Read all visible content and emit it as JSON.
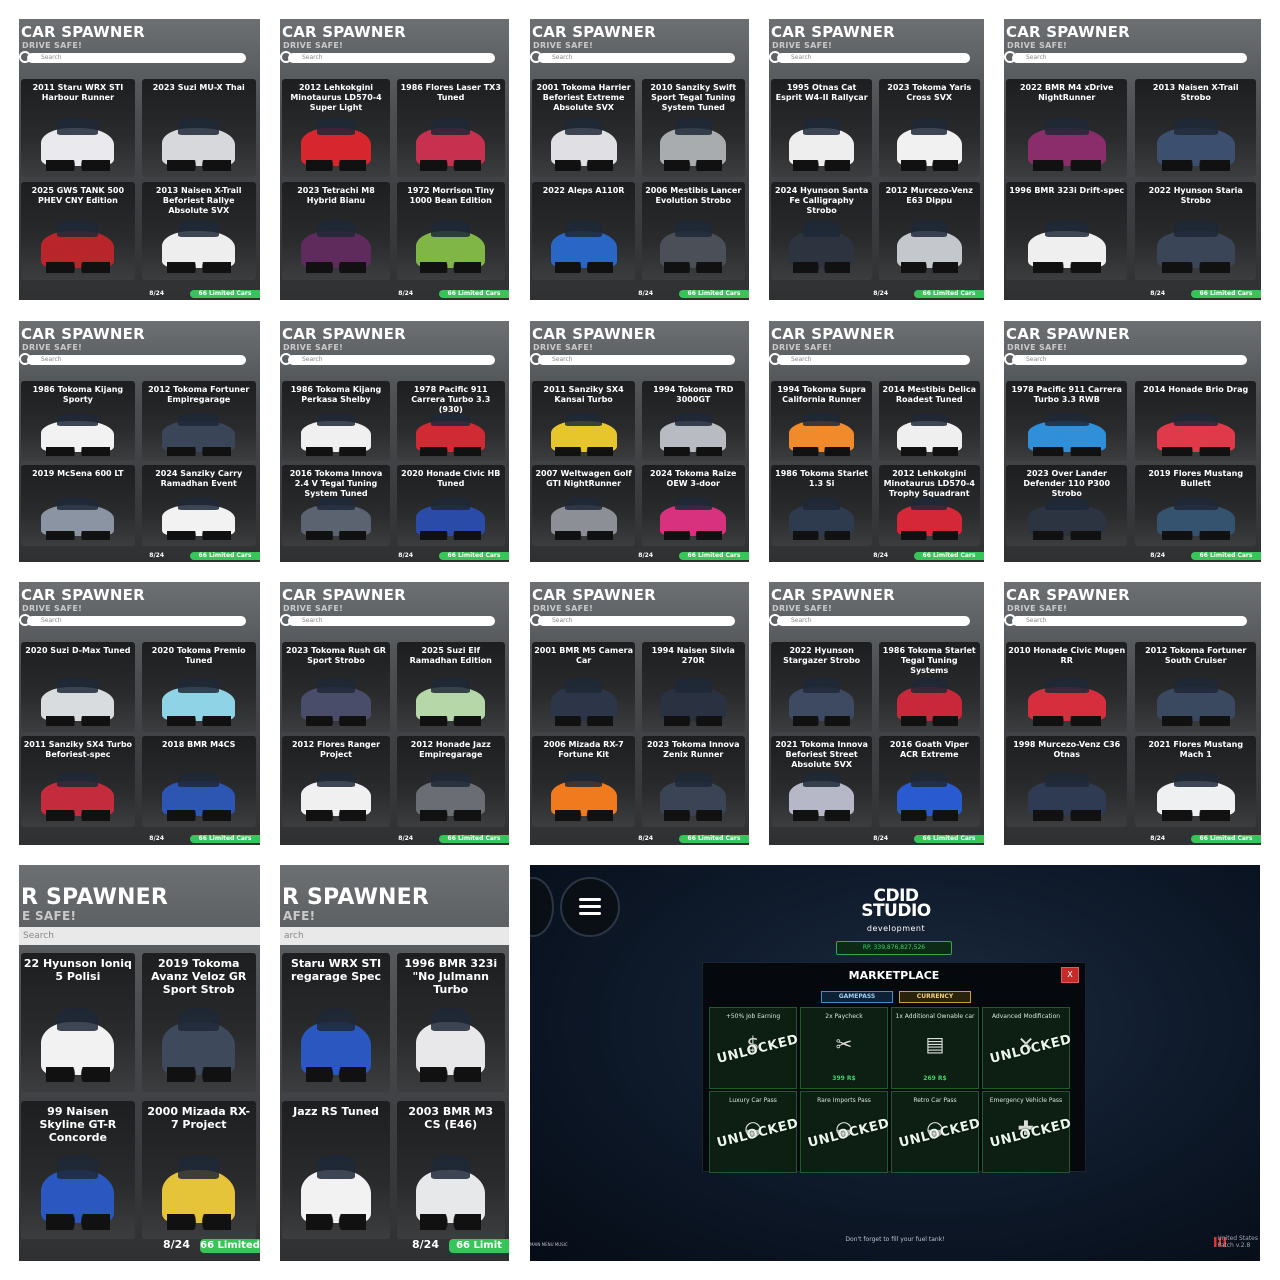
{
  "spawner": {
    "title": "CAR SPAWNER",
    "subtitle": "DRIVE SAFE!",
    "search_placeholder": "Search",
    "count": "8/24",
    "limited": "66 Limited Cars"
  },
  "tiles": [
    {
      "cards": [
        "2011 Staru WRX STI Harbour Runner",
        "2023 Suzi MU-X Thai",
        "2025 GWS TANK 500 PHEV CNY Edition",
        "2013 Naisen X-Trail Beforiest Rallye Absolute SVX"
      ],
      "colors": [
        "#e9e9ee",
        "#d6d8dc",
        "#b8262b",
        "#eeeeee"
      ]
    },
    {
      "cards": [
        "2012 Lehkokgini Minotaurus LD570-4 Super Light",
        "1986 Flores Laser TX3 Tuned",
        "2023 Tetrachi M8 Hybrid Bianu",
        "1972 Morrison Tiny 1000 Bean Edition"
      ],
      "colors": [
        "#d7262e",
        "#c7304e",
        "#5e2b5c",
        "#7fb646"
      ]
    },
    {
      "cards": [
        "2001 Tokoma Harrier Beforiest Extreme Absolute SVX",
        "2010 Sanziky Swift Sport Tegal Tuning System Tuned",
        "2022 Aleps A110R",
        "2006 Mestibis Lancer Evolution Strobo"
      ],
      "colors": [
        "#e0e0e4",
        "#a9acaf",
        "#2a66c6",
        "#4b5058"
      ]
    },
    {
      "cards": [
        "1995 Otnas Cat Esprit W4-II Rallycar",
        "2023 Tokoma Yaris Cross SVX",
        "2024 Hyunson Santa Fe Calligraphy Strobo",
        "2012 Murcezo-Venz E63 Dippu"
      ],
      "colors": [
        "#eeeeee",
        "#f1f1f1",
        "#2d3440",
        "#c4c7cc"
      ]
    },
    {
      "cards": [
        "2022 BMR M4 xDrive NightRunner",
        "2013 Naisen X-Trail Strobo",
        "1996 BMR 323i Drift-spec",
        "2022 Hyunson Staria Strobo"
      ],
      "colors": [
        "#8a2d6a",
        "#3c4f6f",
        "#efefef",
        "#3a4657"
      ]
    },
    {
      "cards": [
        "1986 Tokoma Kijang Sporty",
        "2012 Tokoma Fortuner Empiregarage",
        "2019 McSena 600 LT",
        "2024 Sanziky Carry Ramadhan Event"
      ],
      "colors": [
        "#f2f2f2",
        "#3a4658",
        "#8a94a3",
        "#f2f2f2"
      ]
    },
    {
      "cards": [
        "1986 Tokoma Kijang Perkasa Shelby",
        "1978 Pacific 911 Carrera Turbo 3.3 (930)",
        "2016 Tokoma Innova 2.4 V Tegal Tuning System Tuned",
        "2020 Honade Civic HB Tuned"
      ],
      "colors": [
        "#f0f0f0",
        "#d02a35",
        "#5b6370",
        "#2a4ca8"
      ]
    },
    {
      "cards": [
        "2011 Sanziky SX4 Kansai Turbo",
        "1994 Tokoma TRD 3000GT",
        "2007 Weltwagen Golf GTI NightRunner",
        "2024 Tokoma Raize OEW 3-door"
      ],
      "colors": [
        "#e6c62a",
        "#b8bcc2",
        "#8c9096",
        "#d8327f"
      ]
    },
    {
      "cards": [
        "1994 Tokoma Supra California Runner",
        "2014 Mestibis Delica Roadest Tuned",
        "1986 Tokoma Starlet 1.3 Si",
        "2012 Lehkokgini Minotaurus LD570-4 Trophy Squadrant"
      ],
      "colors": [
        "#f08a2a",
        "#efefef",
        "#2e3a4d",
        "#d42838"
      ]
    },
    {
      "cards": [
        "1978 Pacific 911 Carrera Turbo 3.3 RWB",
        "2014 Honade Brio Drag",
        "2023 Over Lander Defender 110 P300 Strobo",
        "2019 Flores Mustang Bullett"
      ],
      "colors": [
        "#2f8fd8",
        "#e03a4a",
        "#2c3442",
        "#35526e"
      ]
    },
    {
      "cards": [
        "2020 Suzi D-Max Tuned",
        "2020 Tokoma Premio Tuned",
        "2011 Sanziky SX4 Turbo Beforiest-spec",
        "2018 BMR M4CS"
      ],
      "colors": [
        "#d9dcdf",
        "#8fd3e6",
        "#c42c3e",
        "#2d55b2"
      ]
    },
    {
      "cards": [
        "2023 Tokoma Rush GR Sport Strobo",
        "2025 Suzi Elf Ramadhan Edition",
        "2012 Flores Ranger Project",
        "2012 Honade Jazz Empiregarage"
      ],
      "colors": [
        "#4a4d6a",
        "#b6d8a8",
        "#f0f0f0",
        "#6a6e74"
      ]
    },
    {
      "cards": [
        "2001 BMR M5 Camera Car",
        "1994 Naisen Silvia 270R",
        "2006 Mizada RX-7 Fortune Kit",
        "2023 Tokoma Innova Zenix Runner"
      ],
      "colors": [
        "#2c3648",
        "#2a3140",
        "#f07a1e",
        "#3a4454"
      ]
    },
    {
      "cards": [
        "2022 Hyunson Stargazer Strobo",
        "1986 Tokoma Starlet Tegal Tuning Systems",
        "2021 Tokoma Innova Beforiest Street Absolute SVX",
        "2016 Goath Viper ACR Extreme"
      ],
      "colors": [
        "#3d4a62",
        "#c8283a",
        "#b6b8c8",
        "#2a5ad0"
      ]
    },
    {
      "cards": [
        "2010 Honade Civic Mugen RR",
        "2012 Tokoma Fortuner South Cruiser",
        "1998 Murcezo-Venz C36 Otnas",
        "2021 Flores Mustang Mach 1"
      ],
      "colors": [
        "#d72e3e",
        "#3a4860",
        "#2e3b52",
        "#eef0f2"
      ]
    }
  ],
  "big_tiles": [
    {
      "title": "R SPAWNER",
      "subtitle": "E SAFE!",
      "search": "Search",
      "cards": [
        "22 Hyunson Ioniq 5 Polisi",
        "2019 Tokoma Avanz Veloz GR Sport Strob",
        "99 Naisen Skyline GT-R Concorde",
        "2000 Mizada RX-7 Project"
      ],
      "colors": [
        "#f2f2f2",
        "#3e4a5c",
        "#2a58c0",
        "#e6c43a"
      ],
      "count": "8/24",
      "limited": "66 Limited"
    },
    {
      "title": "R SPAWNER",
      "subtitle": "AFE!",
      "search": "arch",
      "cards": [
        "Staru WRX STI regarage Spec",
        "1996 BMR 323i \"No Julmann Turbo",
        "Jazz RS Tuned",
        "2003 BMR M3 CS (E46)"
      ],
      "colors": [
        "#2a58c0",
        "#e8e8ea",
        "#f2f2f2",
        "#e6e8ea"
      ],
      "count": "8/24",
      "limited": "66 Limit"
    }
  ],
  "market": {
    "logo_top": "CDID STUDIO",
    "logo_sub": "development",
    "rp": "RP. 339,876,827,526",
    "title": "MARKETPLACE",
    "close": "X",
    "tab_gamepass": "GAMEPASS",
    "tab_currency": "CURRENCY",
    "unlocked": "UNLOCKED",
    "items": [
      {
        "name": "+50% Job Earning",
        "price": "",
        "unlocked": true,
        "icon": "money-icon"
      },
      {
        "name": "2x Paycheck",
        "price": "399 R$",
        "unlocked": false,
        "icon": "paycheck-icon"
      },
      {
        "name": "1x Additional Ownable car",
        "price": "269 R$",
        "unlocked": false,
        "icon": "garage-icon"
      },
      {
        "name": "Advanced Modification",
        "price": "",
        "unlocked": true,
        "icon": "wrench-icon"
      },
      {
        "name": "Luxury Car Pass",
        "price": "",
        "unlocked": true,
        "icon": "car-icon"
      },
      {
        "name": "Rare Imports Pass",
        "price": "",
        "unlocked": true,
        "icon": "car-icon"
      },
      {
        "name": "Retro Car Pass",
        "price": "",
        "unlocked": true,
        "icon": "car-icon"
      },
      {
        "name": "Emergency Vehicle Pass",
        "price": "",
        "unlocked": true,
        "icon": "siren-icon"
      }
    ],
    "hint": "Don't forget to fill your fuel tank!",
    "main_menu_music": "MAIN MENU MUSIC",
    "region": "United States",
    "patch": "Patch v.2.8"
  }
}
